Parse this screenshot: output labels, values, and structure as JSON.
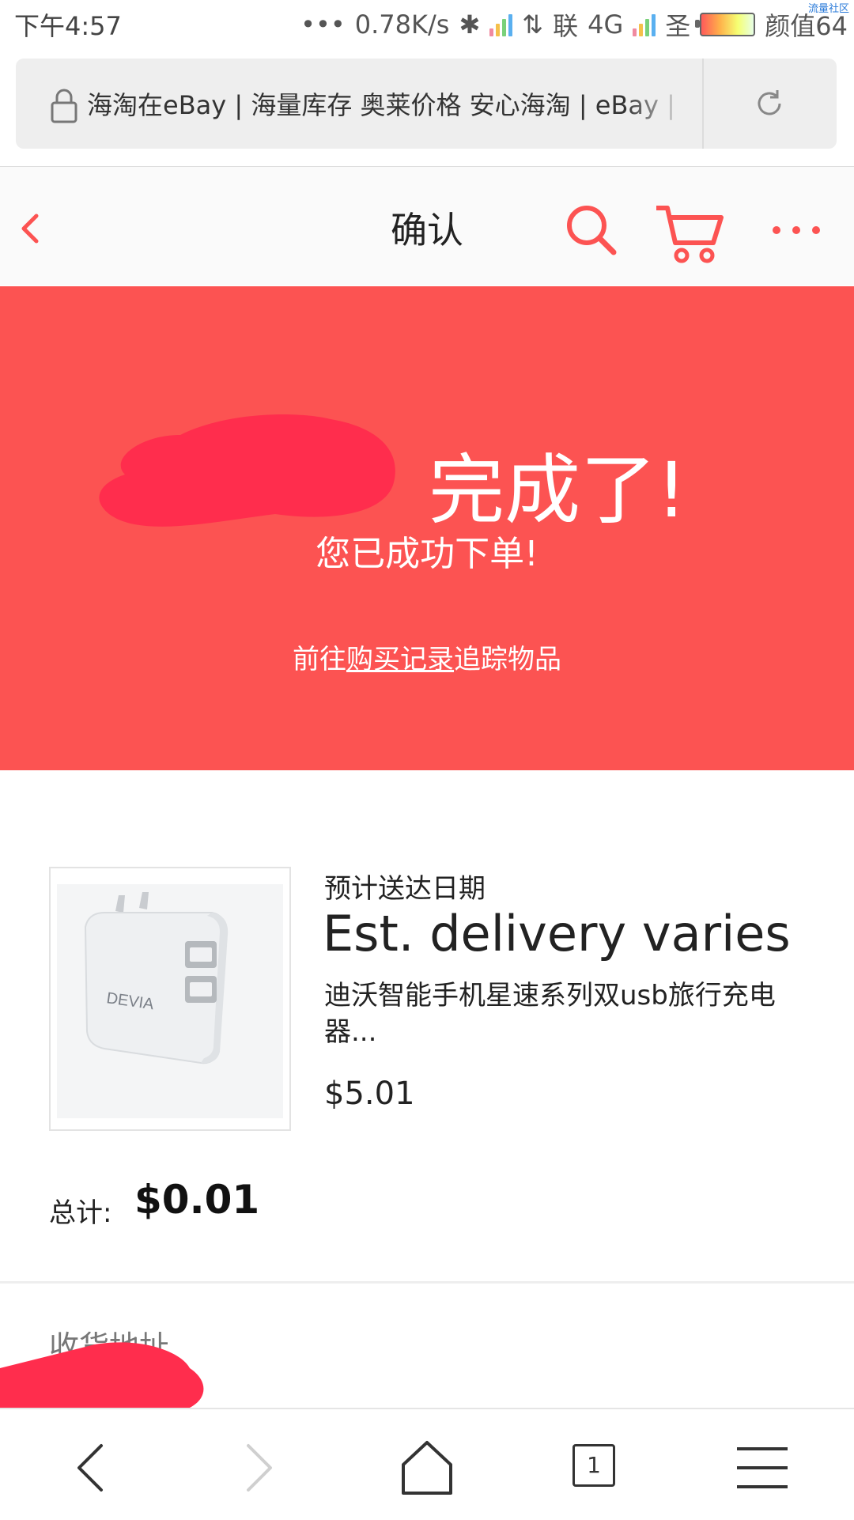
{
  "status_bar": {
    "time": "下午4:57",
    "dots": "•••",
    "speed": "0.78K/s",
    "carrier": "联",
    "network": "4G",
    "carrier2": "圣",
    "beauty": "颜值64",
    "corner_mark": "流量社区"
  },
  "browser": {
    "url_title": "海淘在eBay | 海量库存 奥莱价格 安心海淘 | eBay |",
    "tabs_count": "1"
  },
  "header": {
    "title": "确认"
  },
  "banner": {
    "done_text": "完成了!",
    "success_text": "您已成功下单!",
    "track_prefix": "前往",
    "track_link": "购买记录",
    "track_suffix": "追踪物品"
  },
  "item": {
    "delivery_label": "预计送达日期",
    "delivery_value": "Est. delivery varies",
    "title": "迪沃智能手机星速系列双usb旅行充电器...",
    "price": "$5.01",
    "brand_on_image": "DEVIA"
  },
  "total": {
    "label": "总计:",
    "value": "$0.01"
  },
  "shipping": {
    "label": "收货地址"
  },
  "colors": {
    "accent": "#fc5352",
    "redact": "#ff2d4d"
  }
}
